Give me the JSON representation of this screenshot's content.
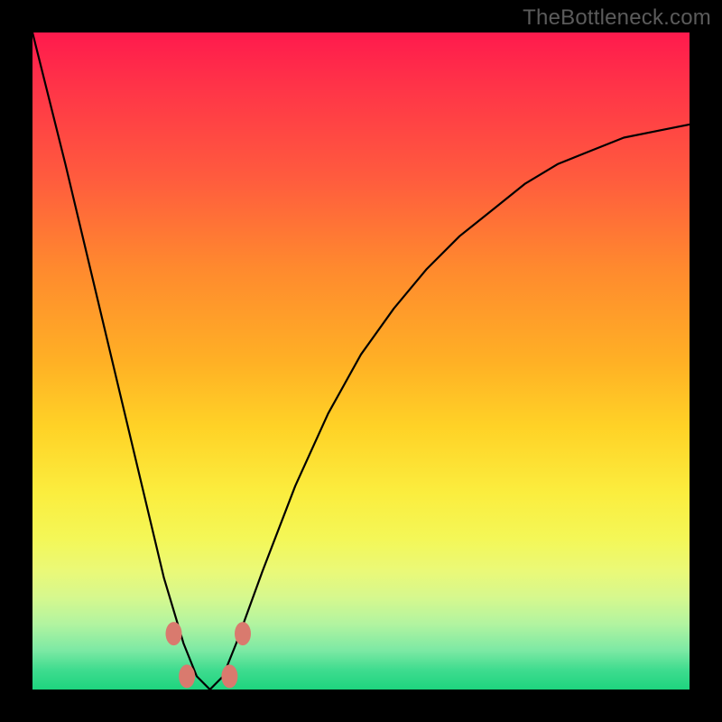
{
  "watermark": "TheBottleneck.com",
  "colors": {
    "frame": "#000000",
    "curve": "#000000",
    "marker": "#d97a6e",
    "gradient_stops": [
      {
        "pct": 0,
        "hex": "#ff1a4d"
      },
      {
        "pct": 8,
        "hex": "#ff3348"
      },
      {
        "pct": 22,
        "hex": "#ff5b3e"
      },
      {
        "pct": 36,
        "hex": "#ff8a2e"
      },
      {
        "pct": 50,
        "hex": "#ffb025"
      },
      {
        "pct": 60,
        "hex": "#ffd226"
      },
      {
        "pct": 70,
        "hex": "#fbed3e"
      },
      {
        "pct": 77,
        "hex": "#f4f757"
      },
      {
        "pct": 82,
        "hex": "#eaf978"
      },
      {
        "pct": 86,
        "hex": "#d6f88e"
      },
      {
        "pct": 90,
        "hex": "#b2f4a0"
      },
      {
        "pct": 94,
        "hex": "#7de9a4"
      },
      {
        "pct": 97,
        "hex": "#3fdc8f"
      },
      {
        "pct": 100,
        "hex": "#1ed47e"
      }
    ]
  },
  "chart_data": {
    "type": "line",
    "title": "",
    "xlabel": "",
    "ylabel": "",
    "note": "Bottleneck-style V curve. Background vertical gradient encodes bottleneck severity (red=high at top, green=low at bottom). The black curve shows bottleneck vs an implied x axis, dipping to ~0 near x≈0.27 of the plot width. Axes are unlabeled; values below are read off as fractions of plot width (x) and plot height (y, 0 at bottom).",
    "x": [
      0.0,
      0.05,
      0.1,
      0.15,
      0.2,
      0.23,
      0.25,
      0.27,
      0.29,
      0.31,
      0.35,
      0.4,
      0.45,
      0.5,
      0.55,
      0.6,
      0.65,
      0.7,
      0.75,
      0.8,
      0.85,
      0.9,
      0.95,
      1.0
    ],
    "y": [
      1.0,
      0.8,
      0.59,
      0.38,
      0.17,
      0.07,
      0.02,
      0.0,
      0.02,
      0.07,
      0.18,
      0.31,
      0.42,
      0.51,
      0.58,
      0.64,
      0.69,
      0.73,
      0.77,
      0.8,
      0.82,
      0.84,
      0.85,
      0.86
    ],
    "ylim": [
      0,
      1
    ],
    "xlim": [
      0,
      1
    ],
    "markers_xy": [
      [
        0.215,
        0.085
      ],
      [
        0.235,
        0.02
      ],
      [
        0.3,
        0.02
      ],
      [
        0.32,
        0.085
      ]
    ]
  }
}
